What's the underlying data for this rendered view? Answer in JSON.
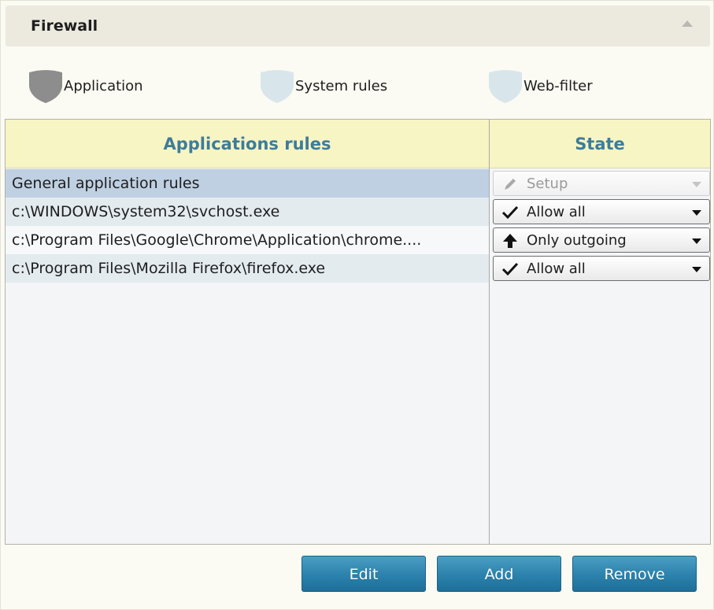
{
  "header": {
    "title": "Firewall"
  },
  "tabs": [
    {
      "label": "Application",
      "icon": "shield-icon",
      "active": true
    },
    {
      "label": "System rules",
      "icon": "shield-icon",
      "active": false
    },
    {
      "label": "Web-filter",
      "icon": "shield-icon",
      "active": false
    }
  ],
  "table": {
    "columns": [
      "Applications rules",
      "State"
    ],
    "rows": [
      {
        "name": "General application rules",
        "state": "Setup",
        "state_icon": "pencil-icon",
        "selected": true,
        "disabled": true
      },
      {
        "name": "c:\\WINDOWS\\system32\\svchost.exe",
        "state": "Allow all",
        "state_icon": "checkmark-icon"
      },
      {
        "name": "c:\\Program Files\\Google\\Chrome\\Application\\chrome....",
        "state": "Only outgoing",
        "state_icon": "arrow-up-icon"
      },
      {
        "name": "c:\\Program Files\\Mozilla Firefox\\firefox.exe",
        "state": "Allow all",
        "state_icon": "checkmark-icon"
      }
    ]
  },
  "footer": {
    "edit_label": "Edit",
    "add_label": "Add",
    "remove_label": "Remove"
  },
  "colors": {
    "accent": "#2d84ae",
    "header_text": "#3e7c9a",
    "selected_row": "#bfd0e2",
    "column_header_bg": "#f8f5c4"
  }
}
